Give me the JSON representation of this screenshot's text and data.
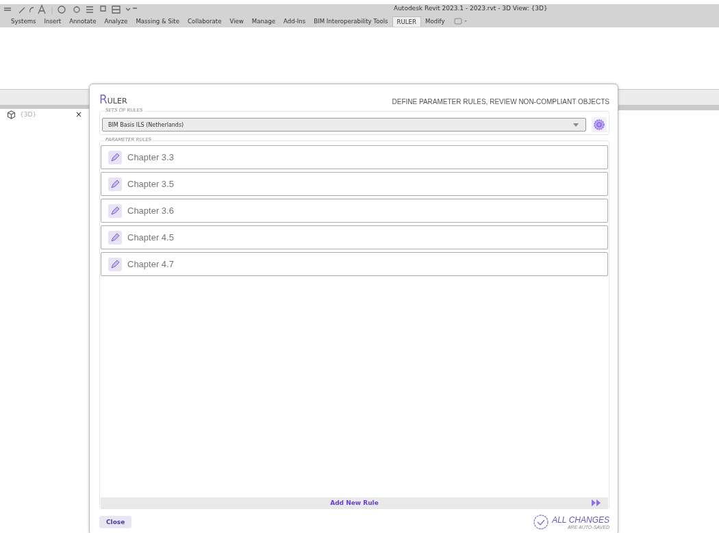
{
  "window": {
    "title": "Autodesk Revit 2023.1 - 2023.rvt - 3D View: {3D}"
  },
  "ribbon_tabs": [
    {
      "label": "Systems",
      "selected": false
    },
    {
      "label": "Insert",
      "selected": false
    },
    {
      "label": "Annotate",
      "selected": false
    },
    {
      "label": "Analyze",
      "selected": false
    },
    {
      "label": "Massing & Site",
      "selected": false
    },
    {
      "label": "Collaborate",
      "selected": false
    },
    {
      "label": "View",
      "selected": false
    },
    {
      "label": "Manage",
      "selected": false
    },
    {
      "label": "Add-Ins",
      "selected": false
    },
    {
      "label": "BIM Interoperability Tools",
      "selected": false
    },
    {
      "label": "RULER",
      "selected": true
    },
    {
      "label": "Modify",
      "selected": false
    }
  ],
  "view_tab": {
    "label": "{3D}",
    "close": "×"
  },
  "dialog": {
    "title": "RULER",
    "subtitle": "DEFINE PARAMETER RULES, REVIEW NON-COMPLIANT OBJECTS",
    "sets_legend": "SETS OF RULES",
    "set_value": "BIM Basis ILS (Netherlands)",
    "rules_legend": "PARAMETER RULES",
    "rules": [
      {
        "name": "Chapter 3.3"
      },
      {
        "name": "Chapter 3.5"
      },
      {
        "name": "Chapter 3.6"
      },
      {
        "name": "Chapter 4.5"
      },
      {
        "name": "Chapter 4.7"
      }
    ],
    "add_rule": "Add New Rule",
    "close": "Close",
    "saved_title": "ALL CHANGES",
    "saved_sub": "ARE AUTO-SAVED"
  }
}
